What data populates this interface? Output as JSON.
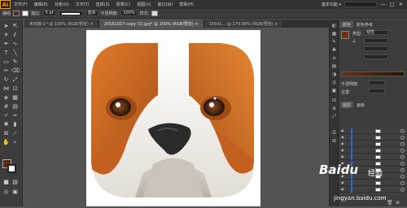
{
  "app": {
    "logo": "Ai"
  },
  "menu": {
    "items": [
      "文件(F)",
      "编辑(E)",
      "对象(O)",
      "文字(T)",
      "选择(S)",
      "效果(C)",
      "视图(V)",
      "窗口(W)",
      "帮助(H)"
    ]
  },
  "workspace": {
    "label": "基本功能 ▾"
  },
  "window_controls": {
    "minimize": "—",
    "maximize": "□",
    "close": "✕"
  },
  "control_bar": {
    "mode_label": "编组",
    "stroke_label": "描边:",
    "stroke_value": "5 pt",
    "style_label": "基本",
    "opacity_label": "不透明度:",
    "opacity_value": "100%",
    "style2_label": "样式:"
  },
  "tabs": [
    {
      "label": "未标题-1* @ 100% (RGB/预览) ×",
      "active": false
    },
    {
      "label": "20161027-copy (1).jpg* @ 150% (RGB/预览) ×",
      "active": true
    },
    {
      "label": "15541... @ 179.99% (RGB/预览) ×",
      "active": false
    }
  ],
  "panels": {
    "color": {
      "tabs": [
        "颜色",
        "颜色参考"
      ],
      "type_label": "类型:",
      "type_value": "线性",
      "angle_label": "∠",
      "opacity_label": "不透明度:",
      "position_label": "位置:"
    },
    "layers": {
      "tabs": [
        "图层",
        "画板"
      ],
      "row_count": 10
    }
  },
  "watermark": {
    "brand": "Baidu",
    "sub": "经验",
    "url": "jingyan.baidu.com"
  },
  "colors": {
    "fur_orange": "#c4601f",
    "face_white": "#f2efe9",
    "nose": "#2b2b2b",
    "eye": "#3b1e0f",
    "accent": "#2f6bd6"
  }
}
